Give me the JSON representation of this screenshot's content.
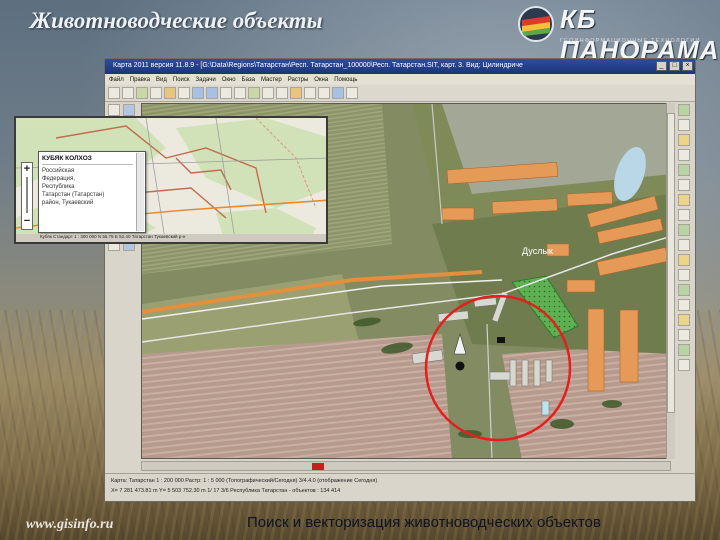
{
  "slide": {
    "title": "Животноводческие объекты",
    "logo_name": "КБ ПАНОРАМА",
    "logo_subtitle": "ГЕОИНФОРМАЦИОННЫЕ ТЕХНОЛОГИИ",
    "footer_url": "www.gisinfo.ru",
    "footer_caption": "Поиск и векторизация животноводческих объектов"
  },
  "app": {
    "window_title": "Карта 2011 версия 11.8.9 - [G:\\Data\\Regions\\Татарстан\\Респ. Татарстан_100000\\Респ. Татарстан.SIT, карт. 3. Вид: Цилиндриче",
    "menu": [
      "Файл",
      "Правка",
      "Вид",
      "Поиск",
      "Задачи",
      "Окно",
      "База",
      "Мастер",
      "Растры",
      "Окна",
      "Помощь"
    ],
    "window_buttons": [
      "_",
      "□",
      "×"
    ],
    "map_label": "Дуслык",
    "status_line1": "Карта: Татарстан  1 : 200 000   Растр: 1 : 5 000   (Топографический/Сегодня)   3/4.4.0 (отображение   Сегодня)",
    "status_line2": "X= 7 281 473.81 m    Y= 5 503 752.30 m    1/ 17 3/6    Республика Татарстан - объектов : 134 414"
  },
  "inset": {
    "popup_title": "КУБЯК КОЛХОЗ",
    "popup_lines": [
      "Российская",
      "Федерация,",
      "Республика",
      "Татарстан (Татарстан)",
      "район, Тукаевский"
    ],
    "zoom_in": "+",
    "zoom_out": "−",
    "status": "Кубяк  Стандарт  1 : 300 000  N 55.75 E 52.40  Татарстан  Тукаевский р-н"
  },
  "colors": {
    "highlight_circle": "#e3201f",
    "roads": "#e58f3c",
    "buildings_orange": "#e69a58",
    "livestock_zone": "#48a842"
  }
}
